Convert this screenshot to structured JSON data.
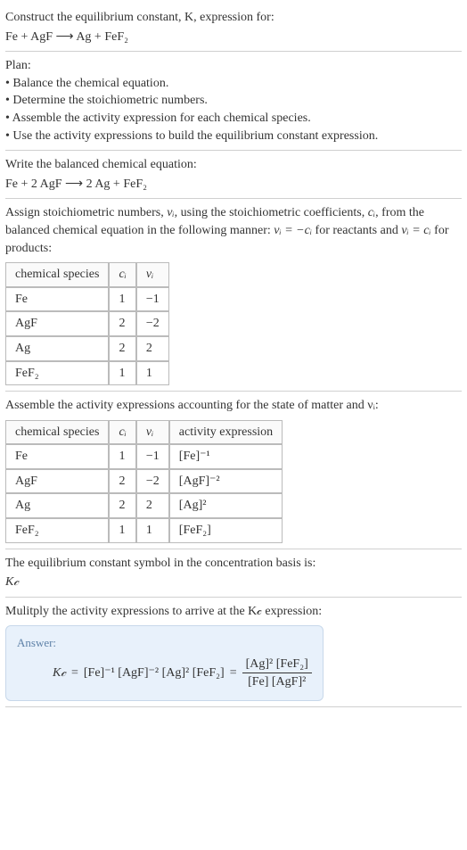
{
  "s1": {
    "line1": "Construct the equilibrium constant, K, expression for:",
    "eq": "Fe + AgF ⟶ Ag + FeF₂"
  },
  "plan": {
    "title": "Plan:",
    "b1": "• Balance the chemical equation.",
    "b2": "• Determine the stoichiometric numbers.",
    "b3": "• Assemble the activity expression for each chemical species.",
    "b4": "• Use the activity expressions to build the equilibrium constant expression."
  },
  "balanced": {
    "line": "Write the balanced chemical equation:",
    "eq": "Fe + 2 AgF ⟶ 2 Ag + FeF₂"
  },
  "stoich": {
    "p1a": "Assign stoichiometric numbers, ",
    "nu": "νᵢ",
    "p1b": ", using the stoichiometric coefficients, ",
    "ci": "cᵢ",
    "p1c": ", from the balanced chemical equation in the following manner: ",
    "rel1": "νᵢ = −cᵢ",
    "p1d": " for reactants and ",
    "rel2": "νᵢ = cᵢ",
    "p1e": " for products:",
    "h1": "chemical species",
    "h2": "cᵢ",
    "h3": "νᵢ",
    "rows": [
      {
        "sp": "Fe",
        "c": "1",
        "n": "−1"
      },
      {
        "sp": "AgF",
        "c": "2",
        "n": "−2"
      },
      {
        "sp": "Ag",
        "c": "2",
        "n": "2"
      },
      {
        "sp": "FeF₂",
        "c": "1",
        "n": "1"
      }
    ]
  },
  "activity": {
    "line": "Assemble the activity expressions accounting for the state of matter and νᵢ:",
    "h1": "chemical species",
    "h2": "cᵢ",
    "h3": "νᵢ",
    "h4": "activity expression",
    "rows": [
      {
        "sp": "Fe",
        "c": "1",
        "n": "−1",
        "a": "[Fe]⁻¹"
      },
      {
        "sp": "AgF",
        "c": "2",
        "n": "−2",
        "a": "[AgF]⁻²"
      },
      {
        "sp": "Ag",
        "c": "2",
        "n": "2",
        "a": "[Ag]²"
      },
      {
        "sp": "FeF₂",
        "c": "1",
        "n": "1",
        "a": "[FeF₂]"
      }
    ]
  },
  "symbol": {
    "line": "The equilibrium constant symbol in the concentration basis is:",
    "kc": "K𝒸"
  },
  "final": {
    "line": "Mulitply the activity expressions to arrive at the K𝒸 expression:",
    "answer": "Answer:",
    "kc": "K𝒸",
    "eq": " = ",
    "lhs": "[Fe]⁻¹ [AgF]⁻² [Ag]² [FeF₂]",
    "eq2": " = ",
    "num": "[Ag]² [FeF₂]",
    "den": "[Fe] [AgF]²"
  }
}
